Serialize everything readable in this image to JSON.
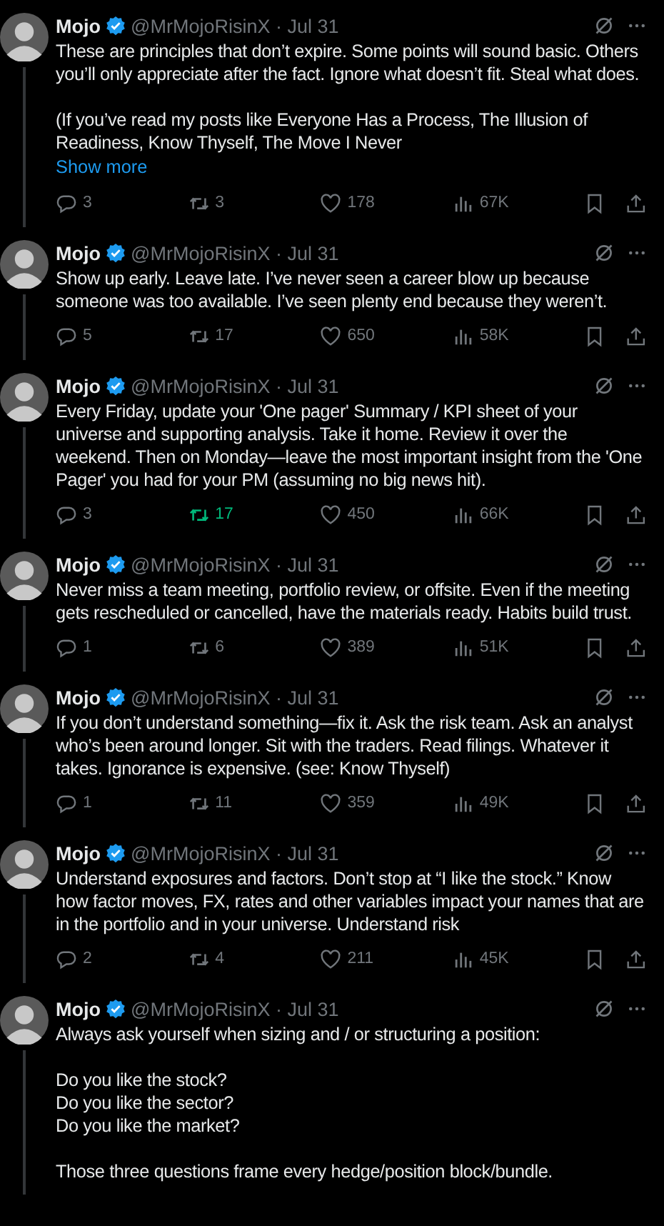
{
  "tweets": [
    {
      "name": "Mojo",
      "meta": "@MrMojoRisinX · Jul 31",
      "body": "These are principles that don’t expire. Some points will sound basic. Others you’ll only appreciate after the fact. Ignore what doesn’t fit. Steal what does.\n\n(If you’ve read my posts like Everyone Has a Process, The Illusion of Readiness, Know Thyself, The Move I Never",
      "show_more": "Show more",
      "replies": "3",
      "reposts": "3",
      "reposted": false,
      "likes": "178",
      "views": "67K"
    },
    {
      "name": "Mojo",
      "meta": "@MrMojoRisinX · Jul 31",
      "body": "Show up early. Leave late. I’ve never seen a career blow up because someone was too available. I’ve seen plenty end because they weren’t.",
      "replies": "5",
      "reposts": "17",
      "reposted": false,
      "likes": "650",
      "views": "58K"
    },
    {
      "name": "Mojo",
      "meta": "@MrMojoRisinX · Jul 31",
      "body": "Every Friday, update your 'One pager' Summary / KPI sheet of your universe and supporting analysis. Take it home. Review it over the weekend. Then on Monday—leave the most important insight from the 'One Pager' you had for your PM (assuming no big news hit).",
      "replies": "3",
      "reposts": "17",
      "reposted": true,
      "likes": "450",
      "views": "66K"
    },
    {
      "name": "Mojo",
      "meta": "@MrMojoRisinX · Jul 31",
      "body": "Never miss a team meeting, portfolio review, or offsite. Even if the meeting gets rescheduled or cancelled, have the materials ready. Habits build trust.",
      "replies": "1",
      "reposts": "6",
      "reposted": false,
      "likes": "389",
      "views": "51K"
    },
    {
      "name": "Mojo",
      "meta": "@MrMojoRisinX · Jul 31",
      "body": "If you don’t understand something—fix it. Ask the risk team. Ask an analyst who’s been around longer. Sit with the traders. Read filings. Whatever it takes. Ignorance is expensive. (see: Know Thyself)",
      "replies": "1",
      "reposts": "11",
      "reposted": false,
      "likes": "359",
      "views": "49K"
    },
    {
      "name": "Mojo",
      "meta": "@MrMojoRisinX · Jul 31",
      "body": "Understand exposures and factors. Don’t stop at “I like the stock.” Know how factor moves, FX, rates and other variables impact your names that are in the portfolio and in your universe. Understand risk",
      "replies": "2",
      "reposts": "4",
      "reposted": false,
      "likes": "211",
      "views": "45K"
    },
    {
      "name": "Mojo",
      "meta": "@MrMojoRisinX · Jul 31",
      "body": "Always ask yourself when sizing and / or structuring a position:\n\nDo you like the stock?\nDo you like the sector?\nDo you like the market?\n\nThose three questions frame every hedge/position block/bundle."
    }
  ]
}
